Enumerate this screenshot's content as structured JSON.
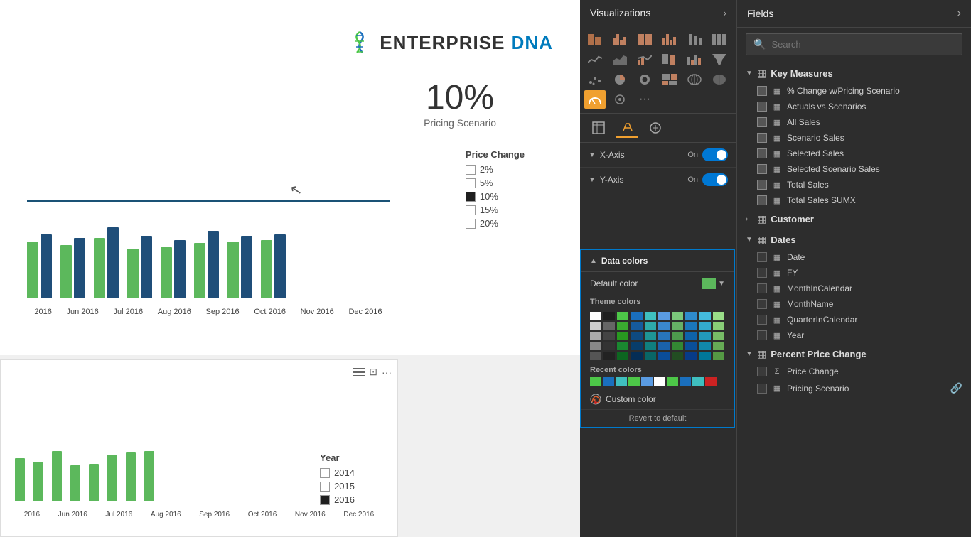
{
  "viz_panel": {
    "title": "Visualizations",
    "arrow": "›",
    "tabs": [
      {
        "label": "⊞",
        "active": false
      },
      {
        "label": "🖌",
        "active": true
      },
      {
        "label": "⊙",
        "active": false
      }
    ],
    "axes": [
      {
        "label": "X-Axis",
        "state": "On"
      },
      {
        "label": "Y-Axis",
        "state": "On"
      }
    ],
    "data_colors": {
      "header": "Data colors",
      "default_color_label": "Default color",
      "theme_colors_title": "Theme colors",
      "recent_colors_title": "Recent colors",
      "custom_color_label": "Custom color",
      "revert_label": "Revert to default"
    }
  },
  "fields_panel": {
    "title": "Fields",
    "arrow": "›",
    "search_placeholder": "Search",
    "groups": [
      {
        "name": "Key Measures",
        "expanded": true,
        "icon": "▦",
        "items": [
          {
            "name": "% Change w/Pricing Scenario",
            "checked": true,
            "type": "measure"
          },
          {
            "name": "Actuals vs Scenarios",
            "checked": true,
            "type": "measure"
          },
          {
            "name": "All Sales",
            "checked": true,
            "type": "measure"
          },
          {
            "name": "Scenario Sales",
            "checked": true,
            "type": "measure"
          },
          {
            "name": "Selected Sales",
            "checked": true,
            "type": "measure"
          },
          {
            "name": "Selected Scenario Sales",
            "checked": true,
            "type": "measure"
          },
          {
            "name": "Total Sales",
            "checked": true,
            "type": "measure"
          },
          {
            "name": "Total Sales SUMX",
            "checked": true,
            "type": "measure"
          }
        ]
      },
      {
        "name": "Customer",
        "expanded": false,
        "icon": "▦",
        "items": []
      },
      {
        "name": "Dates",
        "expanded": true,
        "icon": "▦",
        "items": [
          {
            "name": "Date",
            "checked": false,
            "type": "field"
          },
          {
            "name": "FY",
            "checked": false,
            "type": "field"
          },
          {
            "name": "MonthInCalendar",
            "checked": false,
            "type": "field"
          },
          {
            "name": "MonthName",
            "checked": false,
            "type": "field"
          },
          {
            "name": "QuarterInCalendar",
            "checked": false,
            "type": "field"
          },
          {
            "name": "Year",
            "checked": false,
            "type": "field"
          }
        ]
      },
      {
        "name": "Percent Price Change",
        "expanded": true,
        "icon": "▦",
        "items": [
          {
            "name": "Price Change",
            "checked": false,
            "type": "sigma"
          },
          {
            "name": "Pricing Scenario",
            "checked": false,
            "type": "field",
            "has_special": true
          }
        ]
      }
    ]
  },
  "chart": {
    "logo_text_1": "ENTERPRISE ",
    "logo_text_2": "DNA",
    "pricing_percent": "10%",
    "pricing_label": "Pricing Scenario",
    "price_change_title": "Price Change",
    "price_change_items": [
      {
        "label": "2%",
        "checked": false
      },
      {
        "label": "5%",
        "checked": false
      },
      {
        "label": "10%",
        "checked": true
      },
      {
        "label": "15%",
        "checked": false
      },
      {
        "label": "20%",
        "checked": false
      }
    ],
    "year_title": "Year",
    "year_items": [
      {
        "label": "2014",
        "checked": false
      },
      {
        "label": "2015",
        "checked": false
      },
      {
        "label": "2016",
        "checked": true
      }
    ],
    "x_labels_top": [
      "2016",
      "Jun 2016",
      "Jul 2016",
      "Aug 2016",
      "Sep 2016",
      "Oct 2016",
      "Nov 2016",
      "Dec 2016"
    ],
    "x_labels_bottom": [
      "2016",
      "Jun 2016",
      "Jul 2016",
      "Aug 2016",
      "Sep 2016",
      "Oct 2016",
      "Nov 2016",
      "Dec 2016"
    ],
    "bar_data_top": [
      {
        "green": 80,
        "blue": 90
      },
      {
        "green": 75,
        "blue": 85
      },
      {
        "green": 85,
        "blue": 100
      },
      {
        "green": 70,
        "blue": 88
      },
      {
        "green": 72,
        "blue": 82
      },
      {
        "green": 78,
        "blue": 95
      },
      {
        "green": 80,
        "blue": 88
      },
      {
        "green": 82,
        "blue": 90
      }
    ],
    "bar_data_bottom": [
      {
        "green": 60,
        "blue": 0
      },
      {
        "green": 55,
        "blue": 0
      },
      {
        "green": 70,
        "blue": 0
      },
      {
        "green": 50,
        "blue": 0
      },
      {
        "green": 52,
        "blue": 0
      },
      {
        "green": 65,
        "blue": 0
      },
      {
        "green": 68,
        "blue": 0
      },
      {
        "green": 70,
        "blue": 0
      }
    ]
  },
  "theme_colors": [
    "#ffffff",
    "#1f1f1f",
    "#4dc748",
    "#1a6fbd",
    "#3fbfbf",
    "#5a9be2",
    "#7bc87b",
    "#2e8bcc",
    "#44bbdd",
    "#99dd88",
    "#cccccc",
    "#666666",
    "#3aaa30",
    "#155a9e",
    "#2eaaaa",
    "#3a88cc",
    "#66b066",
    "#1a77bb",
    "#33aacc",
    "#88cc77",
    "#aaaaaa",
    "#444444",
    "#289920",
    "#0e4a80",
    "#1e9595",
    "#2875bb",
    "#4d9a4d",
    "#0e63aa",
    "#2299bb",
    "#77bb66",
    "#888888",
    "#333333",
    "#1a8830",
    "#083d6a",
    "#107f7f",
    "#1a62aa",
    "#338833",
    "#0a4f99",
    "#1188aa",
    "#66aa55",
    "#555555",
    "#222222",
    "#0d6620",
    "#042d55",
    "#096666",
    "#0a4d99",
    "#224d22",
    "#073b88",
    "#007799",
    "#559944"
  ],
  "recent_colors": [
    "#4dc748",
    "#1a6fbd",
    "#3fbfbf",
    "#4dc748",
    "#5a9be2",
    "#ffffff",
    "#4dc748",
    "#1a6fbd",
    "#3fbfbf",
    "#cc2222"
  ]
}
